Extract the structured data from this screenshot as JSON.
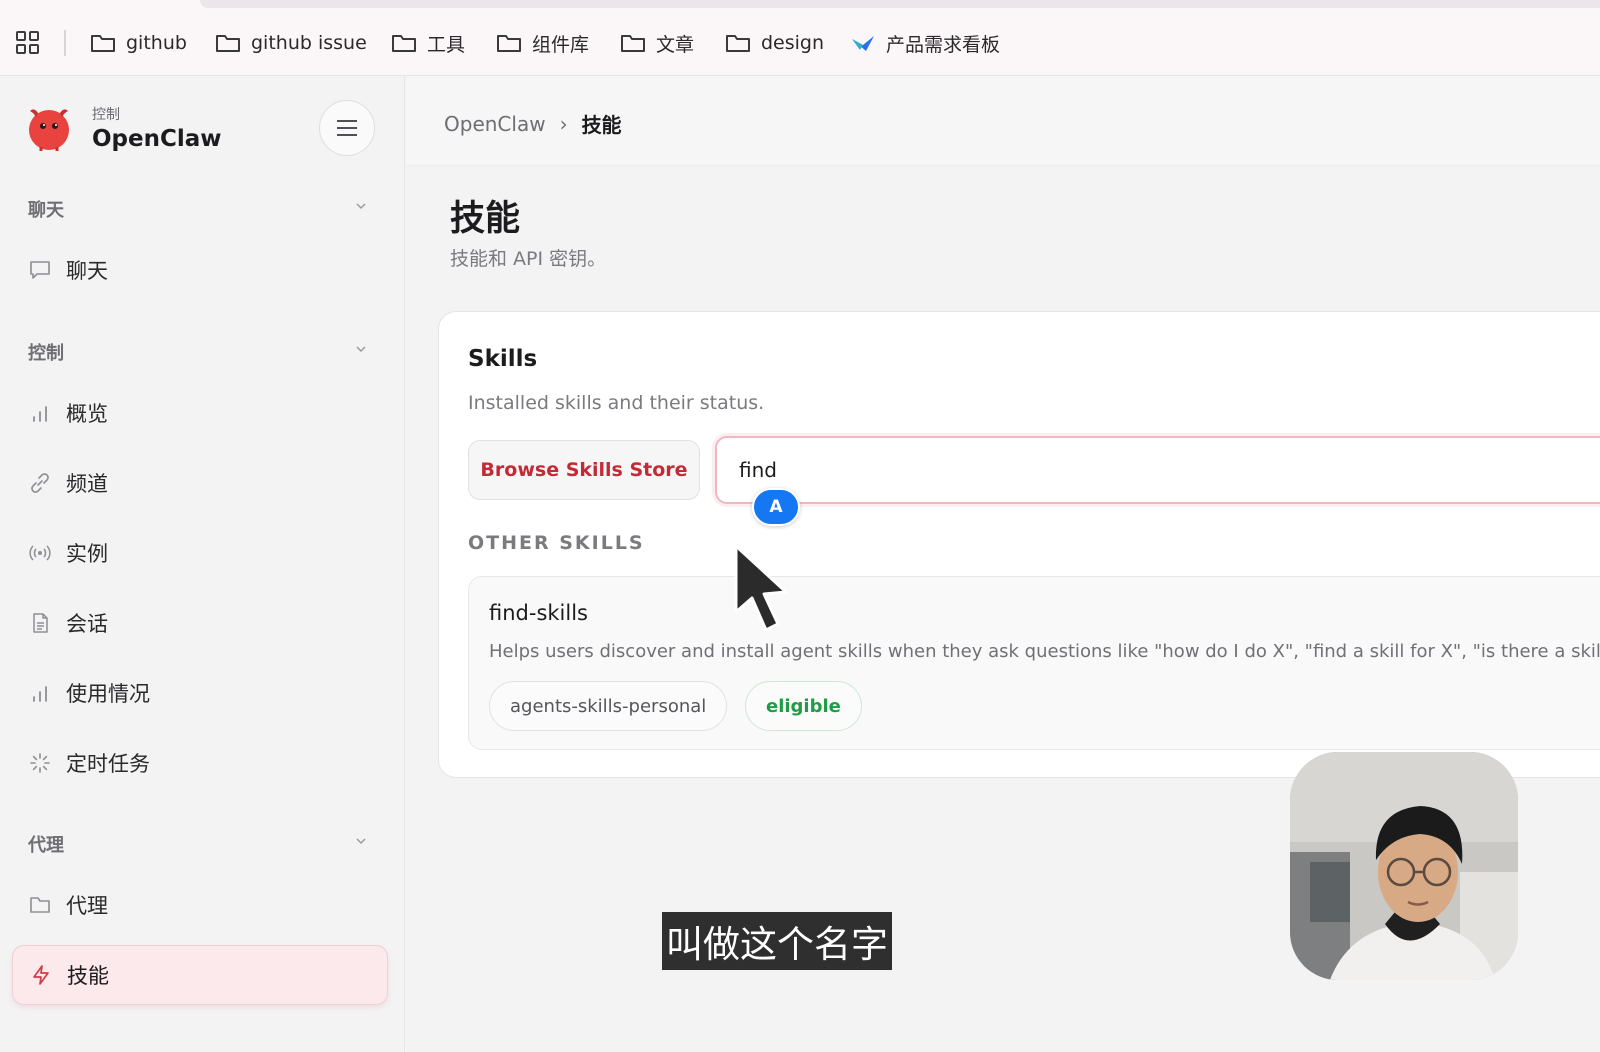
{
  "bookmarks": {
    "items": [
      {
        "label": "github",
        "icon": "folder-icon"
      },
      {
        "label": "github issue",
        "icon": "folder-icon"
      },
      {
        "label": "工具",
        "icon": "folder-icon"
      },
      {
        "label": "组件库",
        "icon": "folder-icon"
      },
      {
        "label": "文章",
        "icon": "folder-icon"
      },
      {
        "label": "design",
        "icon": "folder-icon"
      },
      {
        "label": "产品需求看板",
        "icon": "app-logo-icon"
      }
    ]
  },
  "sidebar": {
    "brand_sub": "控制",
    "brand_title": "OpenClaw",
    "groups": [
      {
        "label": "聊天",
        "items": [
          {
            "label": "聊天",
            "icon": "message-icon"
          }
        ]
      },
      {
        "label": "控制",
        "items": [
          {
            "label": "概览",
            "icon": "bar-chart-icon"
          },
          {
            "label": "频道",
            "icon": "link-icon"
          },
          {
            "label": "实例",
            "icon": "broadcast-icon"
          },
          {
            "label": "会话",
            "icon": "document-icon"
          },
          {
            "label": "使用情况",
            "icon": "bar-chart-icon"
          },
          {
            "label": "定时任务",
            "icon": "loader-icon"
          }
        ]
      },
      {
        "label": "代理",
        "items": [
          {
            "label": "代理",
            "icon": "folder-icon"
          },
          {
            "label": "技能",
            "icon": "lightning-icon",
            "active": true
          }
        ]
      }
    ]
  },
  "breadcrumb": {
    "root": "OpenClaw",
    "separator": "›",
    "current": "技能"
  },
  "page": {
    "title": "技能",
    "subtitle": "技能和 API 密钥。"
  },
  "skills_card": {
    "title": "Skills",
    "subtitle": "Installed skills and their status.",
    "browse_button": "Browse Skills Store",
    "search_value": "find",
    "ime_indicator": "A",
    "section_label": "OTHER SKILLS",
    "skill": {
      "name": "find-skills",
      "description": "Helps users discover and install agent skills when they ask questions like \"how do I do X\", \"find a skill for X\", \"is there a skill",
      "source_chip": "agents-skills-personal",
      "status_chip": "eligible"
    }
  },
  "video_subtitle": "叫做这个名字",
  "colors": {
    "accent": "#c42a36",
    "active_bg": "#fbe9ec",
    "eligible": "#1f9d46",
    "ime_blue": "#1677f2"
  }
}
